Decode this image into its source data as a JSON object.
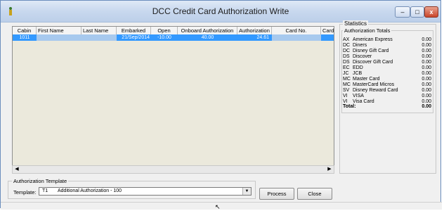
{
  "window": {
    "title": "DCC Credit Card Authorization Write",
    "minimize_glyph": "–",
    "maximize_glyph": "□",
    "close_glyph": "x"
  },
  "grid": {
    "columns": [
      "Cabin",
      "First Name",
      "Last Name",
      "Embarked",
      "Open",
      "Onboard Authorization",
      "Authorization",
      "Card No.",
      "Card"
    ],
    "rows": [
      {
        "cabin": "1011",
        "first_name": "",
        "last_name": "",
        "embarked": "21/Sep/2014",
        "open": "-10.00",
        "onboard_authorization": "40.00",
        "authorization": "24.61",
        "card_no": "",
        "card": ""
      }
    ],
    "scroll_left": "◀",
    "scroll_right": "▶"
  },
  "statistics": {
    "caption": "Statistics",
    "auth_caption": "Authorization Totals",
    "items": [
      {
        "code": "AX",
        "name": "American Express",
        "value": "0.00"
      },
      {
        "code": "DC",
        "name": "Diners",
        "value": "0.00"
      },
      {
        "code": "DC",
        "name": "Disney Gift Card",
        "value": "0.00"
      },
      {
        "code": "DS",
        "name": "Discover",
        "value": "0.00"
      },
      {
        "code": "DS",
        "name": "Discover Gift Card",
        "value": "0.00"
      },
      {
        "code": "EC",
        "name": "EDD",
        "value": "0.00"
      },
      {
        "code": "JC",
        "name": "JCB",
        "value": "0.00"
      },
      {
        "code": "MC",
        "name": "Master Card",
        "value": "0.00"
      },
      {
        "code": "MC",
        "name": "MasterCard Micros",
        "value": "0.00"
      },
      {
        "code": "SV",
        "name": "Disney Reward Card",
        "value": "0.00"
      },
      {
        "code": "VI",
        "name": "VISA",
        "value": "0.00"
      },
      {
        "code": "VI",
        "name": "Visa Card",
        "value": "0.00"
      }
    ],
    "total_label": "Total:",
    "total_value": "0.00"
  },
  "template": {
    "caption": "Authorization Template",
    "label": "Template:",
    "selected_code": "T1",
    "selected_desc": "Additional Authorization - 100",
    "arrow": "▼"
  },
  "buttons": {
    "process": "Process",
    "close": "Close"
  },
  "colors": {
    "selection": "#3399ff",
    "title_gradient_top": "#dfe9f6",
    "close_button": "#c9452a"
  }
}
